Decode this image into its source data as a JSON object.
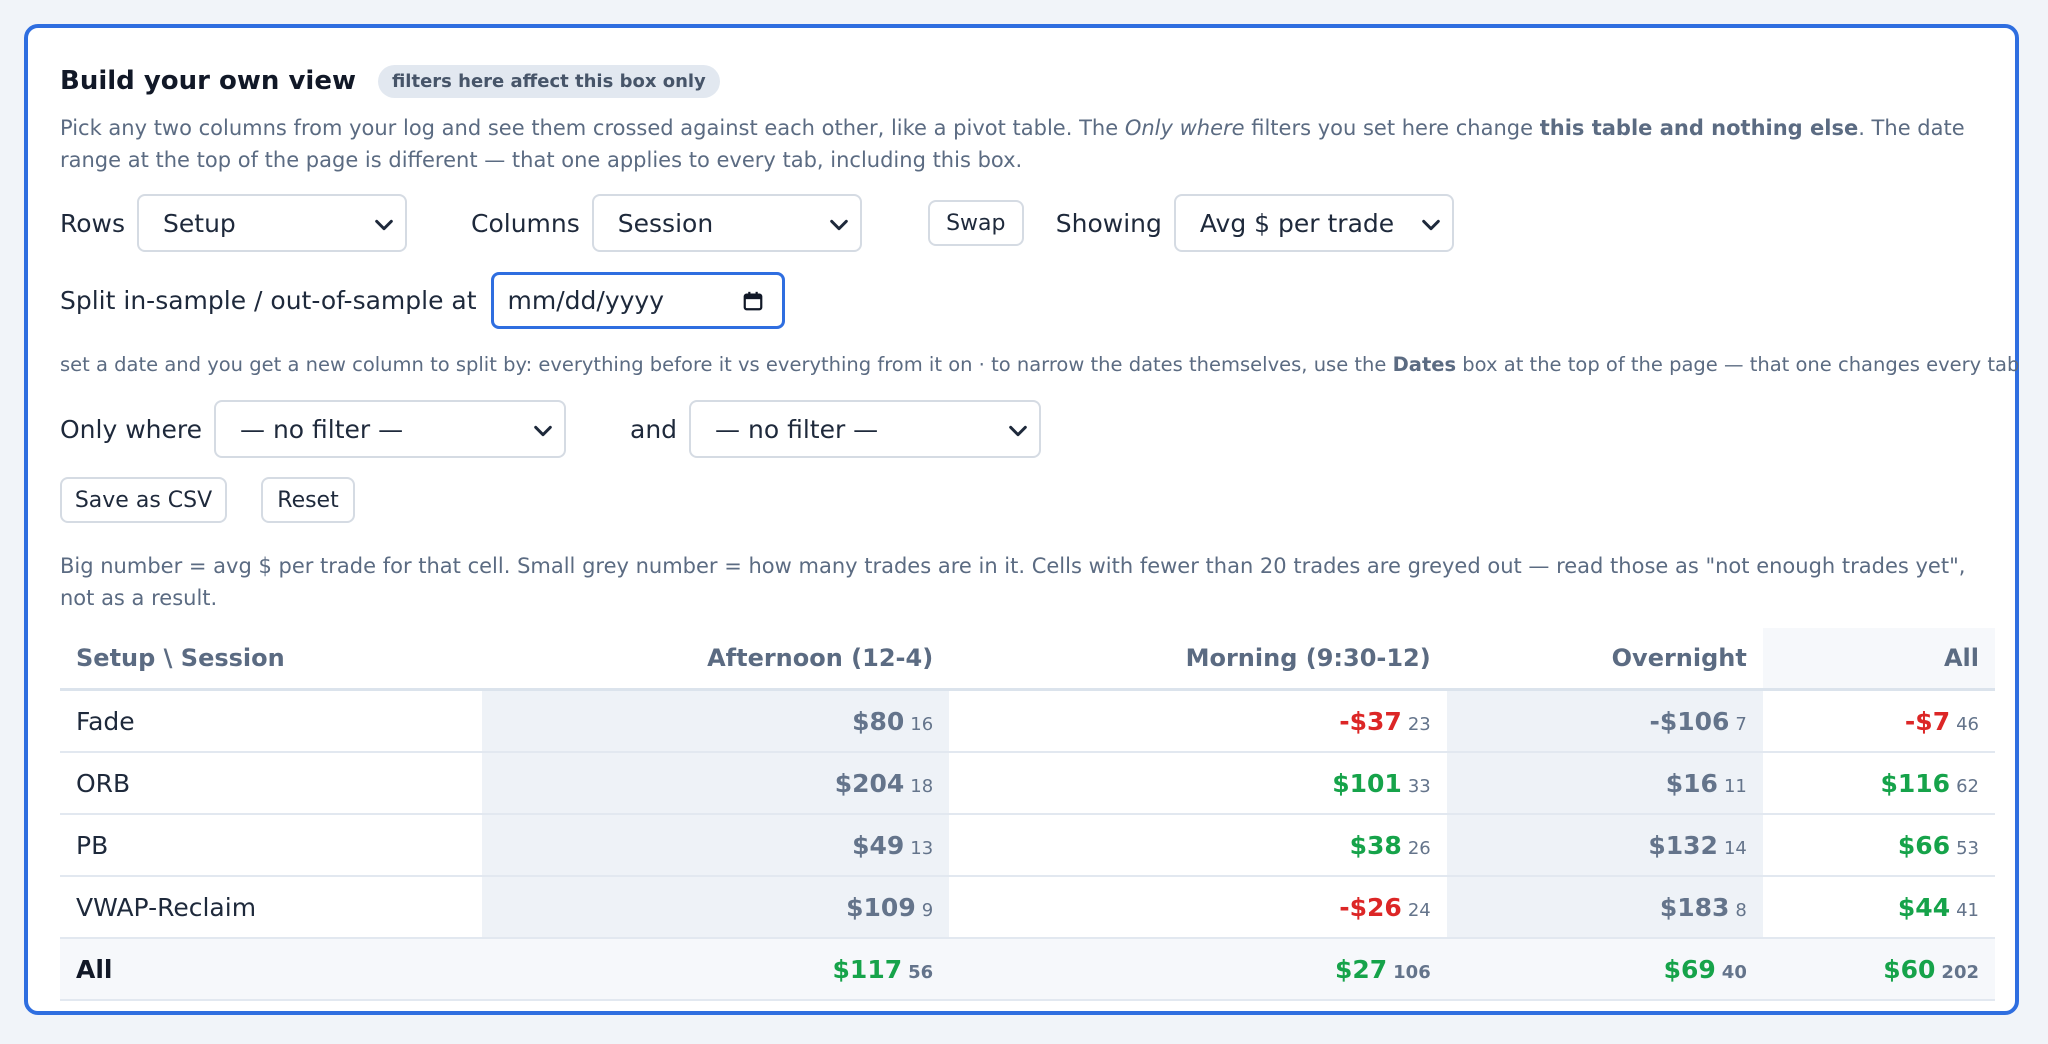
{
  "header": {
    "title": "Build your own view",
    "badge": "filters here affect this box only"
  },
  "intro": {
    "p1": "Pick any two columns from your log and see them crossed against each other, like a pivot table. The ",
    "em": "Only where",
    "p2": " filters you set here change ",
    "strong": "this table and nothing else",
    "p3": ". The date range at the top of the page is different — that one applies to every tab, including this box."
  },
  "controls": {
    "rows_label": "Rows",
    "rows_value": "Setup",
    "columns_label": "Columns",
    "columns_value": "Session",
    "swap_label": "Swap",
    "showing_label": "Showing",
    "showing_value": "Avg $ per trade"
  },
  "split": {
    "label": "Split in-sample / out-of-sample at",
    "placeholder": "mm/dd/yyyy"
  },
  "hint": {
    "p1": "set a date and you get a new column to split by: everything before it vs everything from it on · to narrow the dates themselves, use the ",
    "strong": "Dates",
    "p2": " box at the top of the page — that one changes every tab"
  },
  "filters": {
    "only_where_label": "Only where",
    "filter1_value": "— no filter —",
    "and_label": "and",
    "filter2_value": "— no filter —"
  },
  "actions": {
    "save_csv": "Save as CSV",
    "reset": "Reset"
  },
  "legend": "Big number = avg $ per trade for that cell. Small grey number = how many trades are in it. Cells with fewer than 20 trades are greyed out — read those as \"not enough trades yet\", not as a result.",
  "table": {
    "corner": "Setup \\ Session",
    "columns": [
      "Afternoon (12-4)",
      "Morning (9:30-12)",
      "Overnight",
      "All"
    ],
    "rows": [
      {
        "label": "Fade",
        "cells": [
          {
            "v": "$80",
            "n": "16",
            "s": "mut"
          },
          {
            "v": "-$37",
            "n": "23",
            "s": "neg"
          },
          {
            "v": "-$106",
            "n": "7",
            "s": "mut"
          },
          {
            "v": "-$7",
            "n": "46",
            "s": "neg"
          }
        ]
      },
      {
        "label": "ORB",
        "cells": [
          {
            "v": "$204",
            "n": "18",
            "s": "mut"
          },
          {
            "v": "$101",
            "n": "33",
            "s": "pos"
          },
          {
            "v": "$16",
            "n": "11",
            "s": "mut"
          },
          {
            "v": "$116",
            "n": "62",
            "s": "pos"
          }
        ]
      },
      {
        "label": "PB",
        "cells": [
          {
            "v": "$49",
            "n": "13",
            "s": "mut"
          },
          {
            "v": "$38",
            "n": "26",
            "s": "pos"
          },
          {
            "v": "$132",
            "n": "14",
            "s": "mut"
          },
          {
            "v": "$66",
            "n": "53",
            "s": "pos"
          }
        ]
      },
      {
        "label": "VWAP-Reclaim",
        "cells": [
          {
            "v": "$109",
            "n": "9",
            "s": "mut"
          },
          {
            "v": "-$26",
            "n": "24",
            "s": "neg"
          },
          {
            "v": "$183",
            "n": "8",
            "s": "mut"
          },
          {
            "v": "$44",
            "n": "41",
            "s": "pos"
          }
        ]
      }
    ],
    "total": {
      "label": "All",
      "cells": [
        {
          "v": "$117",
          "n": "56",
          "s": "pos"
        },
        {
          "v": "$27",
          "n": "106",
          "s": "pos"
        },
        {
          "v": "$69",
          "n": "40",
          "s": "pos"
        },
        {
          "v": "$60",
          "n": "202",
          "s": "pos"
        }
      ]
    }
  },
  "colors": {
    "accent": "#2f6ee0",
    "positive": "#16a34a",
    "negative": "#dc2626",
    "muted": "#64748b"
  }
}
